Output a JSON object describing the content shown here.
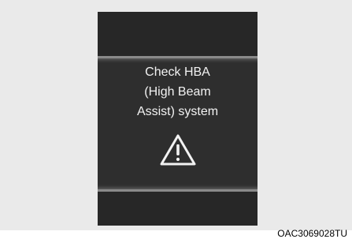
{
  "display": {
    "message_lines": [
      "Check HBA",
      "(High Beam",
      "Assist) system"
    ],
    "icon": "warning-triangle-icon"
  },
  "caption": "OAC3069028TU",
  "colors": {
    "background": "#eaeaea",
    "cluster": "#272727",
    "panel": "#2e2e2e",
    "text": "#f2f2f2"
  }
}
